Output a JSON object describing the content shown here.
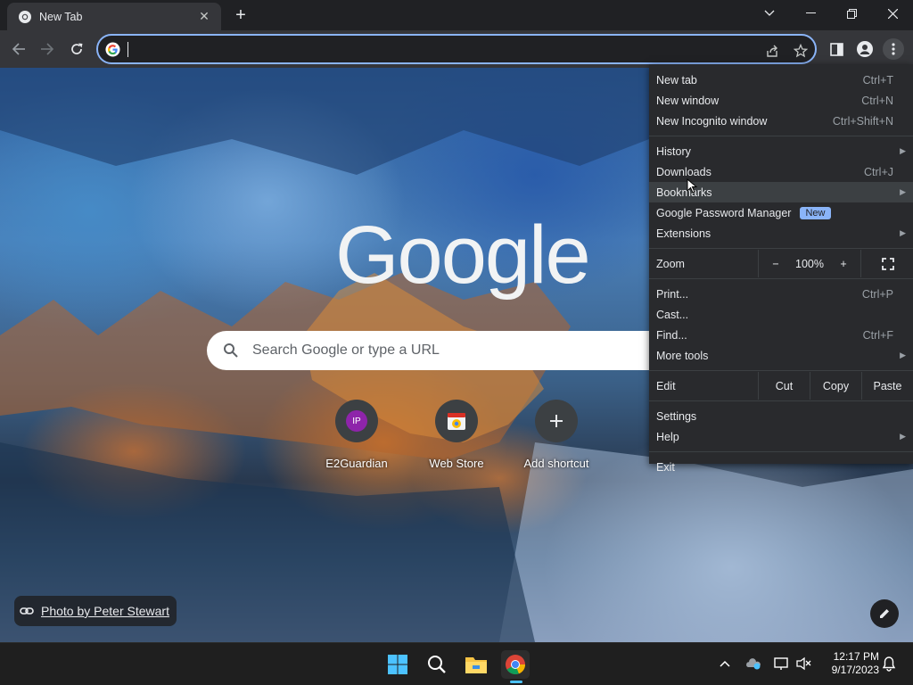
{
  "tab": {
    "title": "New Tab",
    "close_icon": "close-icon"
  },
  "toolbar": {
    "back": "back-arrow-icon",
    "forward": "forward-arrow-icon",
    "reload": "reload-icon",
    "omnibox_value": ""
  },
  "page": {
    "logo_text": "Google",
    "search_placeholder": "Search Google or type a URL",
    "shortcuts": [
      {
        "label": "E2Guardian",
        "icon_text": "IP"
      },
      {
        "label": "Web Store"
      },
      {
        "label": "Add shortcut"
      }
    ],
    "attribution": "Photo by Peter Stewart"
  },
  "menu": {
    "group1": [
      {
        "label": "New tab",
        "shortcut": "Ctrl+T"
      },
      {
        "label": "New window",
        "shortcut": "Ctrl+N"
      },
      {
        "label": "New Incognito window",
        "shortcut": "Ctrl+Shift+N"
      }
    ],
    "history": "History",
    "downloads": {
      "label": "Downloads",
      "shortcut": "Ctrl+J"
    },
    "bookmarks": "Bookmarks",
    "password_manager": {
      "label": "Google Password Manager",
      "badge": "New"
    },
    "extensions": "Extensions",
    "zoom": {
      "label": "Zoom",
      "minus": "−",
      "value": "100%",
      "plus": "+"
    },
    "print": {
      "label": "Print...",
      "shortcut": "Ctrl+P"
    },
    "cast": "Cast...",
    "find": {
      "label": "Find...",
      "shortcut": "Ctrl+F"
    },
    "more_tools": "More tools",
    "edit": {
      "label": "Edit",
      "cut": "Cut",
      "copy": "Copy",
      "paste": "Paste"
    },
    "settings": "Settings",
    "help": "Help",
    "exit": "Exit"
  },
  "taskbar": {
    "time": "12:17 PM",
    "date": "9/17/2023"
  }
}
